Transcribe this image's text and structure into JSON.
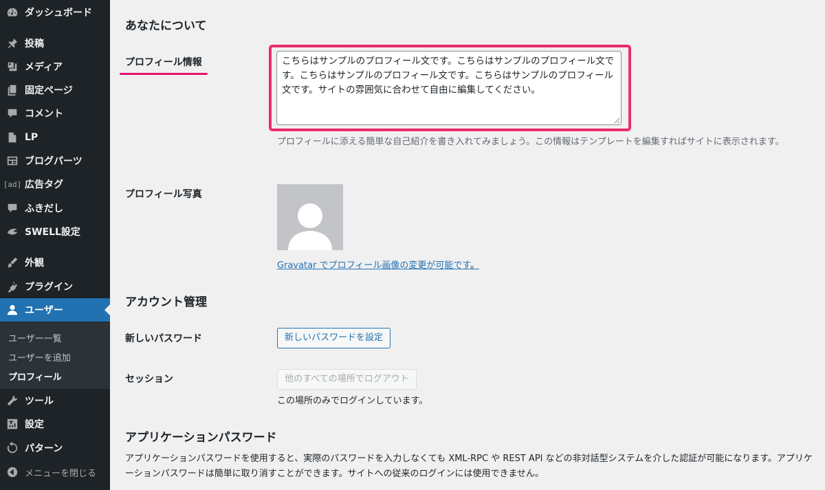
{
  "sidebar": {
    "items": [
      {
        "label": "ダッシュボード",
        "icon": "dashboard-icon"
      },
      {
        "label": "投稿",
        "icon": "pin-icon"
      },
      {
        "label": "メディア",
        "icon": "media-icon"
      },
      {
        "label": "固定ページ",
        "icon": "pages-icon"
      },
      {
        "label": "コメント",
        "icon": "comment-icon"
      },
      {
        "label": "LP",
        "icon": "document-icon"
      },
      {
        "label": "ブログパーツ",
        "icon": "blog-parts-icon"
      },
      {
        "label": "広告タグ",
        "icon": "ad-icon",
        "icon_text": "[ad]"
      },
      {
        "label": "ふきだし",
        "icon": "speech-bubble-icon"
      },
      {
        "label": "SWELL設定",
        "icon": "swell-icon"
      },
      {
        "label": "外観",
        "icon": "brush-icon"
      },
      {
        "label": "プラグイン",
        "icon": "plugin-icon"
      },
      {
        "label": "ユーザー",
        "icon": "user-icon"
      },
      {
        "label": "ツール",
        "icon": "wrench-icon"
      },
      {
        "label": "設定",
        "icon": "settings-icon"
      },
      {
        "label": "パターン",
        "icon": "pattern-icon"
      }
    ],
    "submenu": [
      "ユーザー一覧",
      "ユーザーを追加",
      "プロフィール"
    ],
    "collapse_label": "メニューを閉じる"
  },
  "about": {
    "heading": "あなたについて",
    "bio_label": "プロフィール情報",
    "bio_value": "こちらはサンプルのプロフィール文です。こちらはサンプルのプロフィール文です。こちらはサンプルのプロフィール文です。こちらはサンプルのプロフィール文です。サイトの雰囲気に合わせて自由に編集してください。",
    "bio_desc": "プロフィールに添える簡単な自己紹介を書き入れてみましょう。この情報はテンプレートを編集すればサイトに表示されます。",
    "photo_label": "プロフィール写真",
    "gravatar_link": "Gravatar でプロフィール画像の変更が可能です",
    "gravatar_suffix": "。"
  },
  "account": {
    "heading": "アカウント管理",
    "new_password_label": "新しいパスワード",
    "new_password_button": "新しいパスワードを設定",
    "session_label": "セッション",
    "logout_button": "他のすべての場所でログアウト",
    "session_note": "この場所のみでログインしています。"
  },
  "app_passwords": {
    "heading": "アプリケーションパスワード",
    "desc": "アプリケーションパスワードを使用すると、実際のパスワードを入力しなくても XML-RPC や REST API などの非対話型システムを介した認証が可能になります。アプリケーションパスワードは簡単に取り消すことができます。サイトへの従来のログインには使用できません。"
  },
  "colors": {
    "sidebar_bg": "#1d2327",
    "active_bg": "#2271b1",
    "highlight": "#ea2d6f",
    "link": "#2271b1"
  }
}
